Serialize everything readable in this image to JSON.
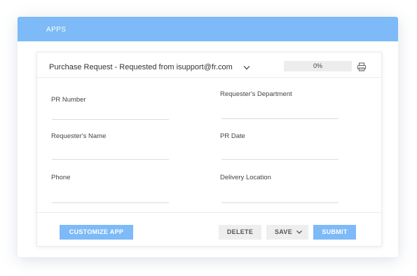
{
  "header": {
    "title": "APPS"
  },
  "form": {
    "title": "Purchase Request - Requested from isupport@fr.com",
    "progress": {
      "value": 0,
      "label": "0%"
    }
  },
  "fields": [
    {
      "label": "PR Number",
      "value": ""
    },
    {
      "label": "Requester's Department",
      "value": ""
    },
    {
      "label": "Requester's Name",
      "value": ""
    },
    {
      "label": "PR Date",
      "value": ""
    },
    {
      "label": "Phone",
      "value": ""
    },
    {
      "label": "Delivery Location",
      "value": ""
    }
  ],
  "footer": {
    "customize_label": "CUSTOMIZE APP",
    "delete_label": "DELETE",
    "save_label": "SAVE",
    "submit_label": "SUBMIT"
  },
  "colors": {
    "accent": "#7dbaf7",
    "button_grey": "#eeeeee",
    "border": "#ececec"
  },
  "icons": {
    "dropdown": "chevron-down-icon",
    "print": "printer-icon",
    "save_menu": "chevron-down-icon"
  }
}
